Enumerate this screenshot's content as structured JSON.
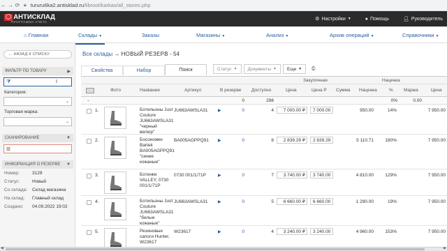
{
  "browser": {
    "url_host": "tururu6ka2.antisklad.ru",
    "url_path": "/libroot/karkas/all_stores.php"
  },
  "app": {
    "logo_main": "АНТИСКЛАД",
    "logo_sub": "ПРОГРАММА УЧЕТА",
    "header_links": [
      "Настройки",
      "Помощь",
      "Руководитель"
    ]
  },
  "menu": {
    "items": [
      "Главная",
      "Склады",
      "Заказы",
      "Магазины",
      "Анализ",
      "Архив операций",
      "Справочники"
    ]
  },
  "sidebar": {
    "back_label": "← НАЗАД К СПИСКУ",
    "filter_section": "ФИЛЬТР ПО ТОВАРУ",
    "category_label": "Категория:",
    "brand_label": "Торговая марка:",
    "scan_section": "СКАНИРОВАНИЕ",
    "info_section": "ИНФОРМАЦИЯ О РЕЗЕРВЕ",
    "info": [
      {
        "label": "Номер:",
        "value": "3129"
      },
      {
        "label": "Статус:",
        "value": "Новый"
      },
      {
        "label": "Со склада:",
        "value": "Склад магазина"
      },
      {
        "label": "На склад:",
        "value": "Главный склад"
      },
      {
        "label": "Создано:",
        "value": "04.09.2022 19:02"
      }
    ]
  },
  "breadcrumb": {
    "link": "Все склады",
    "arrow": "→",
    "title": "НОВЫЙ РЕЗЕРВ",
    "suffix": "- 54"
  },
  "tabs": [
    "Свойства",
    "Набор",
    "Поиск"
  ],
  "toolbar": {
    "status": "Статус",
    "documents": "Документы",
    "more": "Еще"
  },
  "table": {
    "group_headers": {
      "purchase": "Закупочная",
      "markup": "Наценка"
    },
    "columns": [
      "Фото",
      "Название",
      "Артикул",
      "В резерве",
      "Доступно",
      "Цена",
      "Цена Р",
      "Сумма",
      "Наценка",
      "%",
      "Маржа",
      "Цена"
    ],
    "totals": {
      "reserve": "0",
      "available": "298",
      "percent": "0%",
      "margin": "0.00"
    },
    "rows": [
      {
        "n": "1.",
        "name": "Ботильоны Just\nCouture\nJU663AWSLA31\n\"черный\nвелюр\"",
        "sku": "JU663AWSLA31",
        "reserve": "0",
        "avail": "4",
        "price": "7 000.00 ₽",
        "price_r": "7 000.00",
        "markup": "950.00",
        "pct": "14%",
        "retail": "7 950.00"
      },
      {
        "n": "2.",
        "name": "Босоножки\nBartek\nBA005AGPPQ91\n\"синие\nкожаные\"",
        "sku": "BA005AGPPQ91",
        "reserve": "0",
        "avail": "8",
        "price": "2 839.29 ₽",
        "price_r": "2 839.29",
        "markup": "5 110.71",
        "pct": "180%",
        "retail": "7 950.00"
      },
      {
        "n": "3.",
        "name": "Ботинки\nVALLEY, 0730\n001/1/71P",
        "sku": "0730 001/1/71P",
        "reserve": "0",
        "avail": "7",
        "price": "3 740.00 ₽",
        "price_r": "3 740.00",
        "markup": "4 810.00",
        "pct": "129%",
        "retail": "7 950.00"
      },
      {
        "n": "4.",
        "name": "Ботильоны Just\nCouture\nJU663AWSLA31\n\"белые\nкожаные\"",
        "sku": "JU663AWSLA31",
        "reserve": "0",
        "avail": "5",
        "price": "6 660.00 ₽",
        "price_r": "6 660.00",
        "markup": "1 290.00",
        "pct": "19%",
        "retail": "7 950.00"
      },
      {
        "n": "5.",
        "name": "Резиновые\nсапоги Hunter,\nW23617",
        "sku": "W23617",
        "reserve": "0",
        "avail": "4",
        "price": "3 240.00 ₽",
        "price_r": "3 240.00",
        "markup": "4 960.00",
        "pct": "153%",
        "retail": "7 950.00"
      }
    ]
  }
}
